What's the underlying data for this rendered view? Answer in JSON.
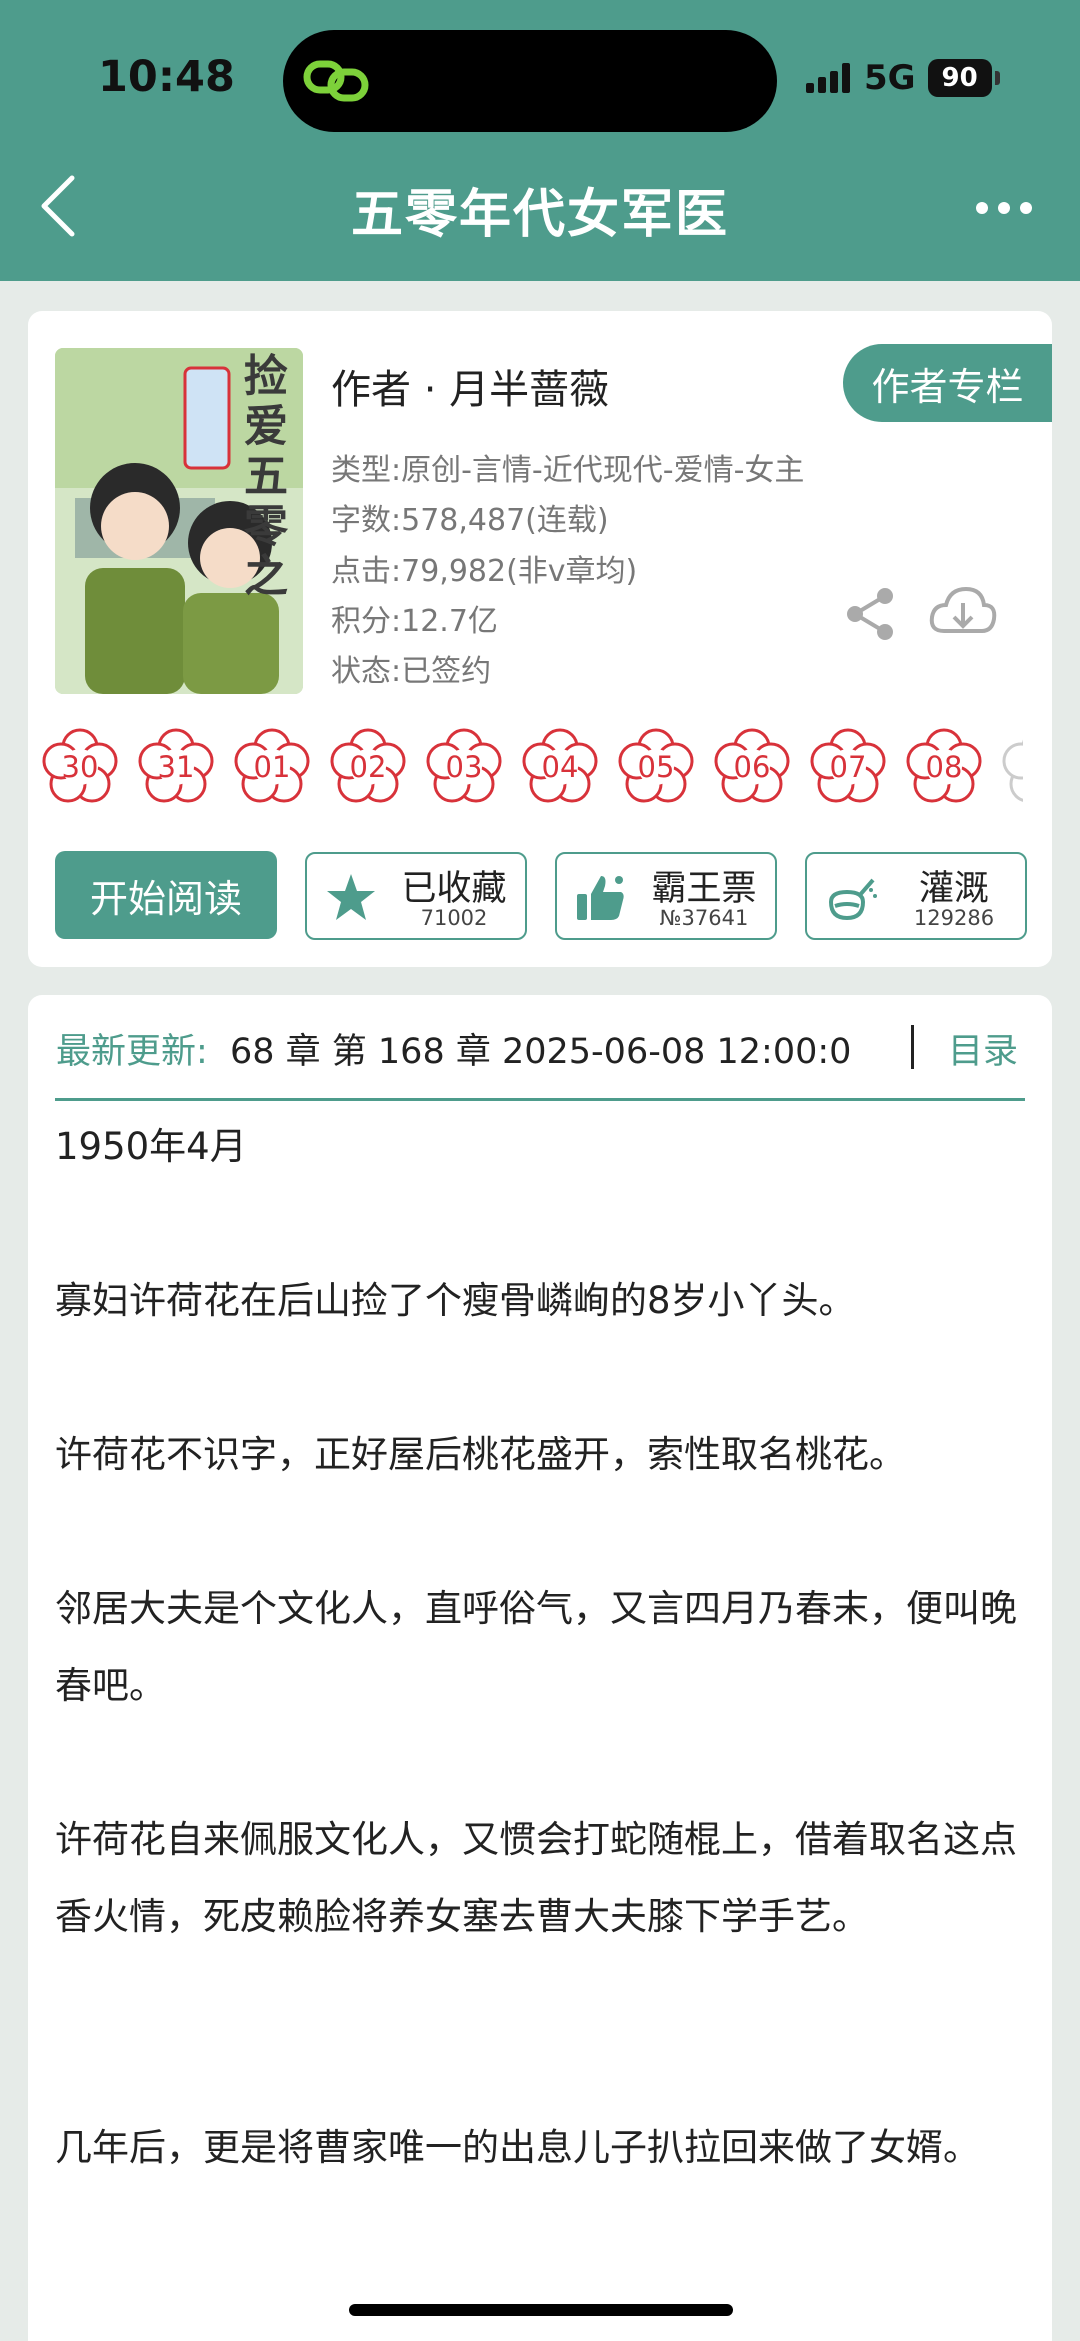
{
  "status_bar": {
    "time": "10:48",
    "network": "5G",
    "battery": "90",
    "icons": [
      "link-app-icon",
      "signal-icon",
      "battery-icon"
    ]
  },
  "header": {
    "title": "五零年代女军医",
    "icons": [
      "back-icon",
      "more-icon"
    ]
  },
  "book": {
    "cover_title": "捡爱五零之",
    "author": "作者 · 月半蔷薇",
    "author_button": "作者专栏",
    "type": "类型:原创-言情-近代现代-爱情-女主",
    "word_count": "字数:578,487(连载)",
    "clicks": "点击:79,982(非v章均)",
    "points": "积分:12.7亿",
    "status": "状态:已签约",
    "icons": [
      "share-icon",
      "download-icon"
    ]
  },
  "flowers": [
    "30",
    "31",
    "01",
    "02",
    "03",
    "04",
    "05",
    "06",
    "07",
    "08"
  ],
  "actions": {
    "read": "开始阅读",
    "collect": {
      "label": "已收藏",
      "count": "71002"
    },
    "ticket": {
      "label": "霸王票",
      "count": "№37641"
    },
    "water": {
      "label": "灌溉",
      "count": "129286"
    }
  },
  "update": {
    "label": "最新更新:",
    "text": "68 章 第 168 章 2025-06-08 12:00:0",
    "toc": "目录"
  },
  "content": {
    "p1": "1950年4月",
    "p2": "寡妇许荷花在后山捡了个瘦骨嶙峋的8岁小丫头。",
    "p3": "许荷花不识字，正好屋后桃花盛开，索性取名桃花。",
    "p4": "邻居大夫是个文化人，直呼俗气，又言四月乃春末，便叫晚春吧。",
    "p5": "许荷花自来佩服文化人，又惯会打蛇随棍上，借着取名这点香火情，死皮赖脸将养女塞去曹大夫膝下学手艺。",
    "p6": "几年后，更是将曹家唯一的出息儿子扒拉回来做了女婿。"
  },
  "colors": {
    "accent": "#4e9c8c",
    "flower": "#d8323a",
    "background": "#e6ebe8"
  }
}
